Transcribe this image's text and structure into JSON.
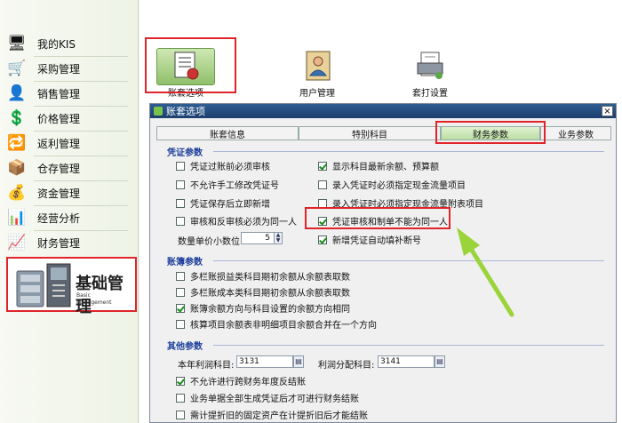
{
  "sidebar": {
    "items": [
      {
        "label": "我的KIS",
        "icon": "monitor-icon"
      },
      {
        "label": "采购管理",
        "icon": "purchase-icon"
      },
      {
        "label": "销售管理",
        "icon": "sales-icon"
      },
      {
        "label": "价格管理",
        "icon": "price-icon"
      },
      {
        "label": "返利管理",
        "icon": "rebate-icon"
      },
      {
        "label": "仓存管理",
        "icon": "warehouse-icon"
      },
      {
        "label": "资金管理",
        "icon": "fund-icon"
      },
      {
        "label": "经营分析",
        "icon": "analysis-icon"
      },
      {
        "label": "财务管理",
        "icon": "finance-icon"
      }
    ],
    "active": {
      "label": "基础管理",
      "sub1": "Basic",
      "sub2": "Management"
    }
  },
  "toolbar": {
    "items": [
      {
        "label": "账套选项"
      },
      {
        "label": "用户管理"
      },
      {
        "label": "套打设置"
      }
    ]
  },
  "dialog": {
    "title": "账套选项",
    "close": "×",
    "tabs": [
      "账套信息",
      "特别科目",
      "财务参数",
      "业务参数"
    ],
    "active_tab": "财务参数",
    "voucher": {
      "heading": "凭证参数",
      "left": [
        {
          "label": "凭证过账前必须审核",
          "checked": false
        },
        {
          "label": "不允许手工修改凭证号",
          "checked": false
        },
        {
          "label": "凭证保存后立即新增",
          "checked": false
        },
        {
          "label": "审核和反审核必须为同一人",
          "checked": false
        }
      ],
      "right": [
        {
          "label": "显示科目最新余额、预算额",
          "checked": true
        },
        {
          "label": "录入凭证时必须指定现金流量项目",
          "checked": false
        },
        {
          "label": "录入凭证时必须指定现金流量附表项目",
          "checked": false
        },
        {
          "label": "凭证审核和制单不能为同一人",
          "checked": true
        },
        {
          "label": "新增凭证自动填补断号",
          "checked": true
        }
      ],
      "decimal_label": "数量单价小数位:",
      "decimal_value": "5"
    },
    "ledger": {
      "heading": "账簿参数",
      "items": [
        {
          "label": "多栏账损益类科目期初余额从余额表取数",
          "checked": false
        },
        {
          "label": "多栏账成本类科目期初余额从余额表取数",
          "checked": false
        },
        {
          "label": "账簿余额方向与科目设置的余额方向相同",
          "checked": true
        },
        {
          "label": "核算项目余额表非明细项目余额合并在一个方向",
          "checked": false
        }
      ]
    },
    "other": {
      "heading": "其他参数",
      "profit_label": "本年利润科目:",
      "profit_value": "3131",
      "dist_label": "利润分配科目:",
      "dist_value": "3141",
      "items": [
        {
          "label": "不允许进行跨财务年度反结账",
          "checked": true
        },
        {
          "label": "业务单据全部生成凭证后才可进行财务结账",
          "checked": false
        },
        {
          "label": "需计提折旧的固定资产在计提折旧后才能结账",
          "checked": false
        }
      ]
    }
  },
  "colors": {
    "highlight": "#e0242a",
    "arrow": "#9bd43a",
    "section": "#1e3f9b"
  }
}
